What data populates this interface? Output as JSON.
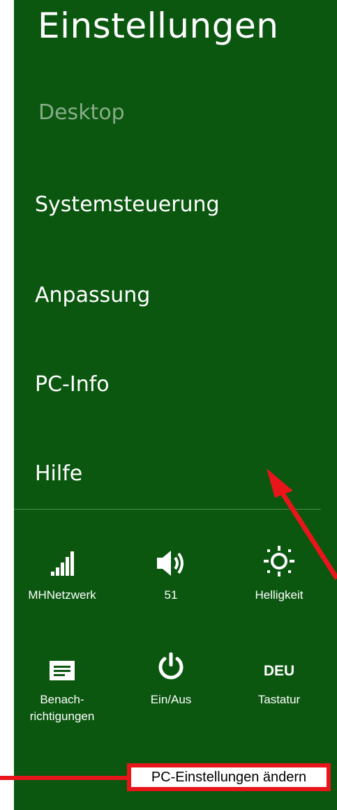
{
  "charms": {
    "title": "Einstellungen",
    "subtitle": "Desktop",
    "menu": [
      {
        "label": "Systemsteuerung"
      },
      {
        "label": "Anpassung"
      },
      {
        "label": "PC-Info"
      },
      {
        "label": "Hilfe"
      }
    ],
    "quick": [
      {
        "label": "MHNetzwerk",
        "icon": "network-signal-icon"
      },
      {
        "label": "51",
        "icon": "volume-icon"
      },
      {
        "label": "Helligkeit",
        "icon": "brightness-icon"
      },
      {
        "label_line1": "Benach-",
        "label_line2": "richtigungen",
        "icon": "notifications-icon"
      },
      {
        "label": "Ein/Aus",
        "icon": "power-icon"
      },
      {
        "icon_text": "DEU",
        "label": "Tastatur",
        "icon": "keyboard-language"
      }
    ],
    "change_settings": "PC-Einstellungen ändern"
  },
  "colors": {
    "panel_bg": "#0b5710",
    "accent_red": "#e8151b",
    "subtitle_text": "#87ad87"
  }
}
